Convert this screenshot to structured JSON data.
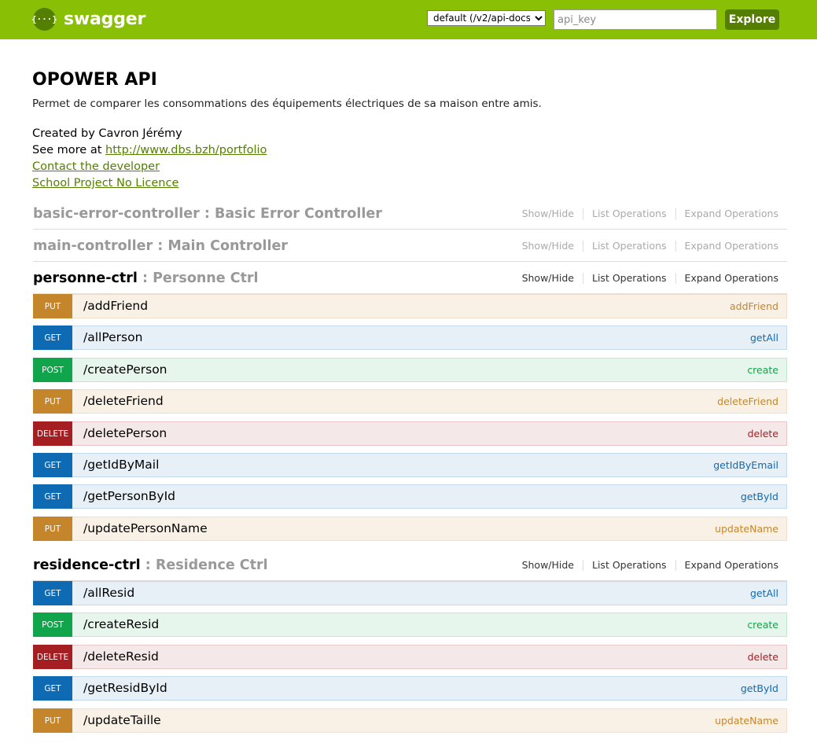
{
  "header": {
    "logo_glyph": "{···}",
    "logo_text": "swagger",
    "spec_selected": "default (/v2/api-docs)",
    "api_key_placeholder": "api_key",
    "explore_label": "Explore",
    "brand_color": "#89bf04"
  },
  "info": {
    "title": "OPOWER API",
    "description": "Permet de comparer les consommations des équipements électriques de sa maison entre amis.",
    "created_by": "Created by Cavron Jérémy",
    "see_more_prefix": "See more at ",
    "see_more_link": "http://www.dbs.bzh/portfolio",
    "contact": "Contact the developer",
    "license": "School Project No Licence"
  },
  "resource_options": {
    "show_hide": "Show/Hide",
    "list_operations": "List Operations",
    "expand_operations": "Expand Operations"
  },
  "resources": [
    {
      "name": "basic-error-controller",
      "sep": " : ",
      "description": "Basic Error Controller",
      "expanded": false
    },
    {
      "name": "main-controller",
      "sep": " : ",
      "description": "Main Controller",
      "expanded": false
    },
    {
      "name": "personne-ctrl",
      "sep": " : ",
      "description": "Personne Ctrl",
      "expanded": true
    },
    {
      "name": "residence-ctrl",
      "sep": " : ",
      "description": "Residence Ctrl",
      "expanded": true
    }
  ],
  "personne_ops": [
    {
      "method": "PUT",
      "path": "/addFriend",
      "nickname": "addFriend"
    },
    {
      "method": "GET",
      "path": "/allPerson",
      "nickname": "getAll"
    },
    {
      "method": "POST",
      "path": "/createPerson",
      "nickname": "create"
    },
    {
      "method": "PUT",
      "path": "/deleteFriend",
      "nickname": "deleteFriend"
    },
    {
      "method": "DELETE",
      "path": "/deletePerson",
      "nickname": "delete"
    },
    {
      "method": "GET",
      "path": "/getIdByMail",
      "nickname": "getIdByEmail"
    },
    {
      "method": "GET",
      "path": "/getPersonById",
      "nickname": "getById"
    },
    {
      "method": "PUT",
      "path": "/updatePersonName",
      "nickname": "updateName"
    }
  ],
  "residence_ops": [
    {
      "method": "GET",
      "path": "/allResid",
      "nickname": "getAll"
    },
    {
      "method": "POST",
      "path": "/createResid",
      "nickname": "create"
    },
    {
      "method": "DELETE",
      "path": "/deleteResid",
      "nickname": "delete"
    },
    {
      "method": "GET",
      "path": "/getResidById",
      "nickname": "getById"
    },
    {
      "method": "PUT",
      "path": "/updateTaille",
      "nickname": "updateName"
    }
  ],
  "method_colors": {
    "GET": "#0f6ab4",
    "POST": "#10a54a",
    "PUT": "#c5862b",
    "DELETE": "#a41e22"
  }
}
